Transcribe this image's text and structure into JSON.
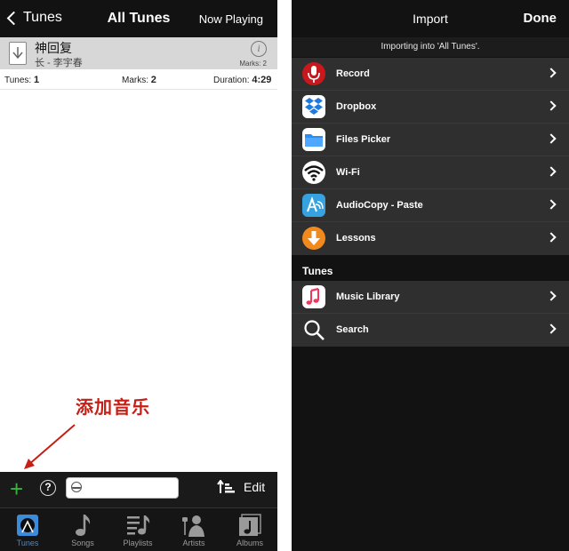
{
  "left": {
    "nav": {
      "back_label": "Tunes",
      "title": "All Tunes",
      "now_playing": "Now Playing"
    },
    "song": {
      "title": "神回复",
      "subtitle": "长 - 李宇春",
      "marks": "Marks: 2"
    },
    "stats": {
      "tunes_label": "Tunes:",
      "tunes_value": "1",
      "marks_label": "Marks:",
      "marks_value": "2",
      "duration_label": "Duration:",
      "duration_value": "4:29"
    },
    "annotation": "添加音乐",
    "toolbar": {
      "add_symbol": "+",
      "help_symbol": "?",
      "search_value": "",
      "edit_label": "Edit"
    },
    "tabs": [
      {
        "label": "Tunes",
        "icon": "tunes-icon",
        "active": true
      },
      {
        "label": "Songs",
        "icon": "music-note-icon"
      },
      {
        "label": "Playlists",
        "icon": "playlist-icon"
      },
      {
        "label": "Artists",
        "icon": "artist-icon"
      },
      {
        "label": "Albums",
        "icon": "album-icon"
      }
    ]
  },
  "right": {
    "nav": {
      "title": "Import",
      "done_label": "Done"
    },
    "subtitle": "Importing into 'All Tunes'.",
    "import_items": [
      {
        "label": "Record",
        "icon": "microphone-icon"
      },
      {
        "label": "Dropbox",
        "icon": "dropbox-icon"
      },
      {
        "label": "Files Picker",
        "icon": "folder-icon"
      },
      {
        "label": "Wi-Fi",
        "icon": "wifi-icon"
      },
      {
        "label": "AudioCopy - Paste",
        "icon": "audiocopy-icon"
      },
      {
        "label": "Lessons",
        "icon": "download-arrow-icon"
      }
    ],
    "section_title": "Tunes",
    "tunes_items": [
      {
        "label": "Music Library",
        "icon": "music-library-icon"
      },
      {
        "label": "Search",
        "icon": "search-icon"
      }
    ]
  },
  "colors": {
    "nav_bg": "#121212",
    "accent_green": "#3cb043",
    "accent_blue": "#3d8bd8",
    "annotation_red": "#c62016",
    "list_bg": "#2f2f2f"
  }
}
